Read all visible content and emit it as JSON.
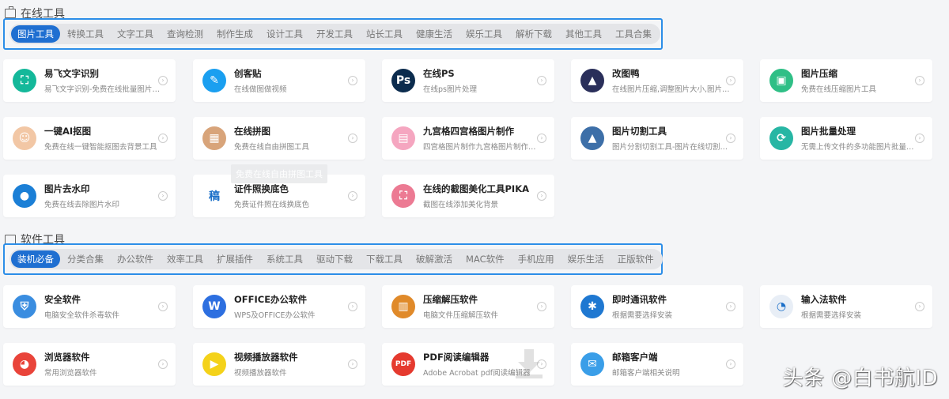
{
  "online": {
    "title": "在线工具",
    "tabs": [
      "图片工具",
      "转换工具",
      "文字工具",
      "查询检测",
      "制作生成",
      "设计工具",
      "开发工具",
      "站长工具",
      "健康生活",
      "娱乐工具",
      "解析下载",
      "其他工具",
      "工具合集"
    ],
    "cards": [
      {
        "title": "易飞文字识别",
        "desc": "易飞文字识别-免费在线批量图片文...",
        "icon": "text-recognition-icon",
        "color": "#14b89a",
        "glyph": "⛶"
      },
      {
        "title": "创客贴",
        "desc": "在线做图做视频",
        "icon": "chuangketie-icon",
        "color": "#1a9ff0",
        "glyph": "✎"
      },
      {
        "title": "在线PS",
        "desc": "在线ps图片处理",
        "icon": "photoshop-icon",
        "color": "#0c2c4e",
        "glyph": "Ps"
      },
      {
        "title": "改图鸭",
        "desc": "在线图片压缩,调整图片大小,图片加...",
        "icon": "gaituya-icon",
        "color": "#2a2f5a",
        "glyph": "▲"
      },
      {
        "title": "图片压缩",
        "desc": "免费在线压缩图片工具",
        "icon": "image-compress-icon",
        "color": "#2fbf86",
        "glyph": "▣"
      },
      {
        "title": "一键AI抠图",
        "desc": "免费在线一键智能抠图去背景工具",
        "icon": "ai-matting-icon",
        "color": "#f2c7a5",
        "glyph": "☺"
      },
      {
        "title": "在线拼图",
        "desc": "免费在线自由拼图工具",
        "icon": "collage-icon",
        "color": "#d8a47a",
        "glyph": "▦"
      },
      {
        "title": "九宫格四宫格图片制作",
        "desc": "四宫格图片制作九宫格图片制作在...",
        "icon": "grid-image-icon",
        "color": "#f5a6c0",
        "glyph": "▤"
      },
      {
        "title": "图片切割工具",
        "desc": "图片分割切割工具-图片在线切割分...",
        "icon": "image-cut-icon",
        "color": "#3d6fa8",
        "glyph": "▲"
      },
      {
        "title": "图片批量处理",
        "desc": "无需上传文件的多功能图片批量处...",
        "icon": "batch-process-icon",
        "color": "#27b6a4",
        "glyph": "⟳"
      },
      {
        "title": "图片去水印",
        "desc": "免费在线去除图片水印",
        "icon": "remove-watermark-icon",
        "color": "#1b7fd6",
        "glyph": "●"
      },
      {
        "title": "证件照换底色",
        "desc": "免费证件照在线换底色",
        "icon": "id-photo-icon",
        "color": "#ffffff",
        "glyph": "稿"
      },
      {
        "title": "在线的截图美化工具PIKA",
        "desc": "截图在线添加美化背景",
        "icon": "pika-icon",
        "color": "#ec7a93",
        "glyph": "⛶"
      }
    ],
    "tooltip": "免费在线自由拼图工具"
  },
  "software": {
    "title": "软件工具",
    "tabs": [
      "装机必备",
      "分类合集",
      "办公软件",
      "效率工具",
      "扩展插件",
      "系统工具",
      "驱动下载",
      "下载工具",
      "破解激活",
      "MAC软件",
      "手机应用",
      "娱乐生活",
      "正版软件"
    ],
    "cards": [
      {
        "title": "安全软件",
        "desc": "电脑安全软件杀毒软件",
        "icon": "security-shield-icon",
        "color": "#3a8de0",
        "glyph": "⛨"
      },
      {
        "title": "OFFICE办公软件",
        "desc": "WPS及OFFICE办公软件",
        "icon": "wps-office-icon",
        "color": "#2d6fe0",
        "glyph": "W"
      },
      {
        "title": "压缩解压软件",
        "desc": "电脑文件压缩解压软件",
        "icon": "archive-icon",
        "color": "#e08a2a",
        "glyph": "▥"
      },
      {
        "title": "即时通讯软件",
        "desc": "根据需要选择安装",
        "icon": "im-chat-icon",
        "color": "#1f78d1",
        "glyph": "✱"
      },
      {
        "title": "输入法软件",
        "desc": "根据需要选择安装",
        "icon": "input-method-icon",
        "color": "#e8eef6",
        "glyph": "◔"
      },
      {
        "title": "浏览器软件",
        "desc": "常用浏览器软件",
        "icon": "browser-icon",
        "color": "#e9443a",
        "glyph": "◕"
      },
      {
        "title": "视频播放器软件",
        "desc": "视频播放器软件",
        "icon": "video-player-icon",
        "color": "#f4d21a",
        "glyph": "▶"
      },
      {
        "title": "PDF阅读编辑器",
        "desc": "Adobe Acrobat pdf阅读编辑器",
        "icon": "pdf-reader-icon",
        "color": "#e53a2f",
        "glyph": "PDF"
      },
      {
        "title": "邮箱客户端",
        "desc": "邮箱客户端相关说明",
        "icon": "email-client-icon",
        "color": "#3a9ee8",
        "glyph": "✉"
      }
    ]
  },
  "watermark": "头条 @白书航ID"
}
